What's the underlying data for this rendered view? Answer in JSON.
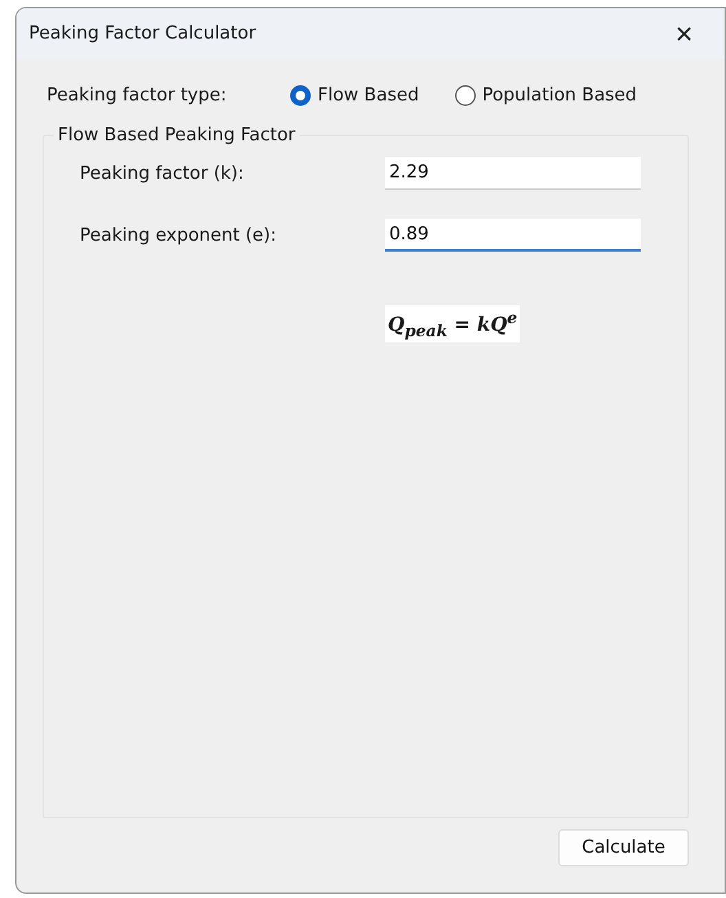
{
  "window": {
    "title": "Peaking Factor Calculator",
    "close": "×"
  },
  "type_selector": {
    "label": "Peaking factor type:",
    "options": [
      {
        "label": "Flow Based",
        "selected": true
      },
      {
        "label": "Population Based",
        "selected": false
      }
    ]
  },
  "group": {
    "title": "Flow Based Peaking Factor",
    "fields": [
      {
        "label": "Peaking factor (k):",
        "value": "2.29",
        "focused": false
      },
      {
        "label": "Peaking exponent (e):",
        "value": "0.89",
        "focused": true
      }
    ],
    "formula": "Q$_{peak}$ = kQ$^{e}$"
  },
  "buttons": [
    {
      "label": "Calculate"
    }
  ]
}
